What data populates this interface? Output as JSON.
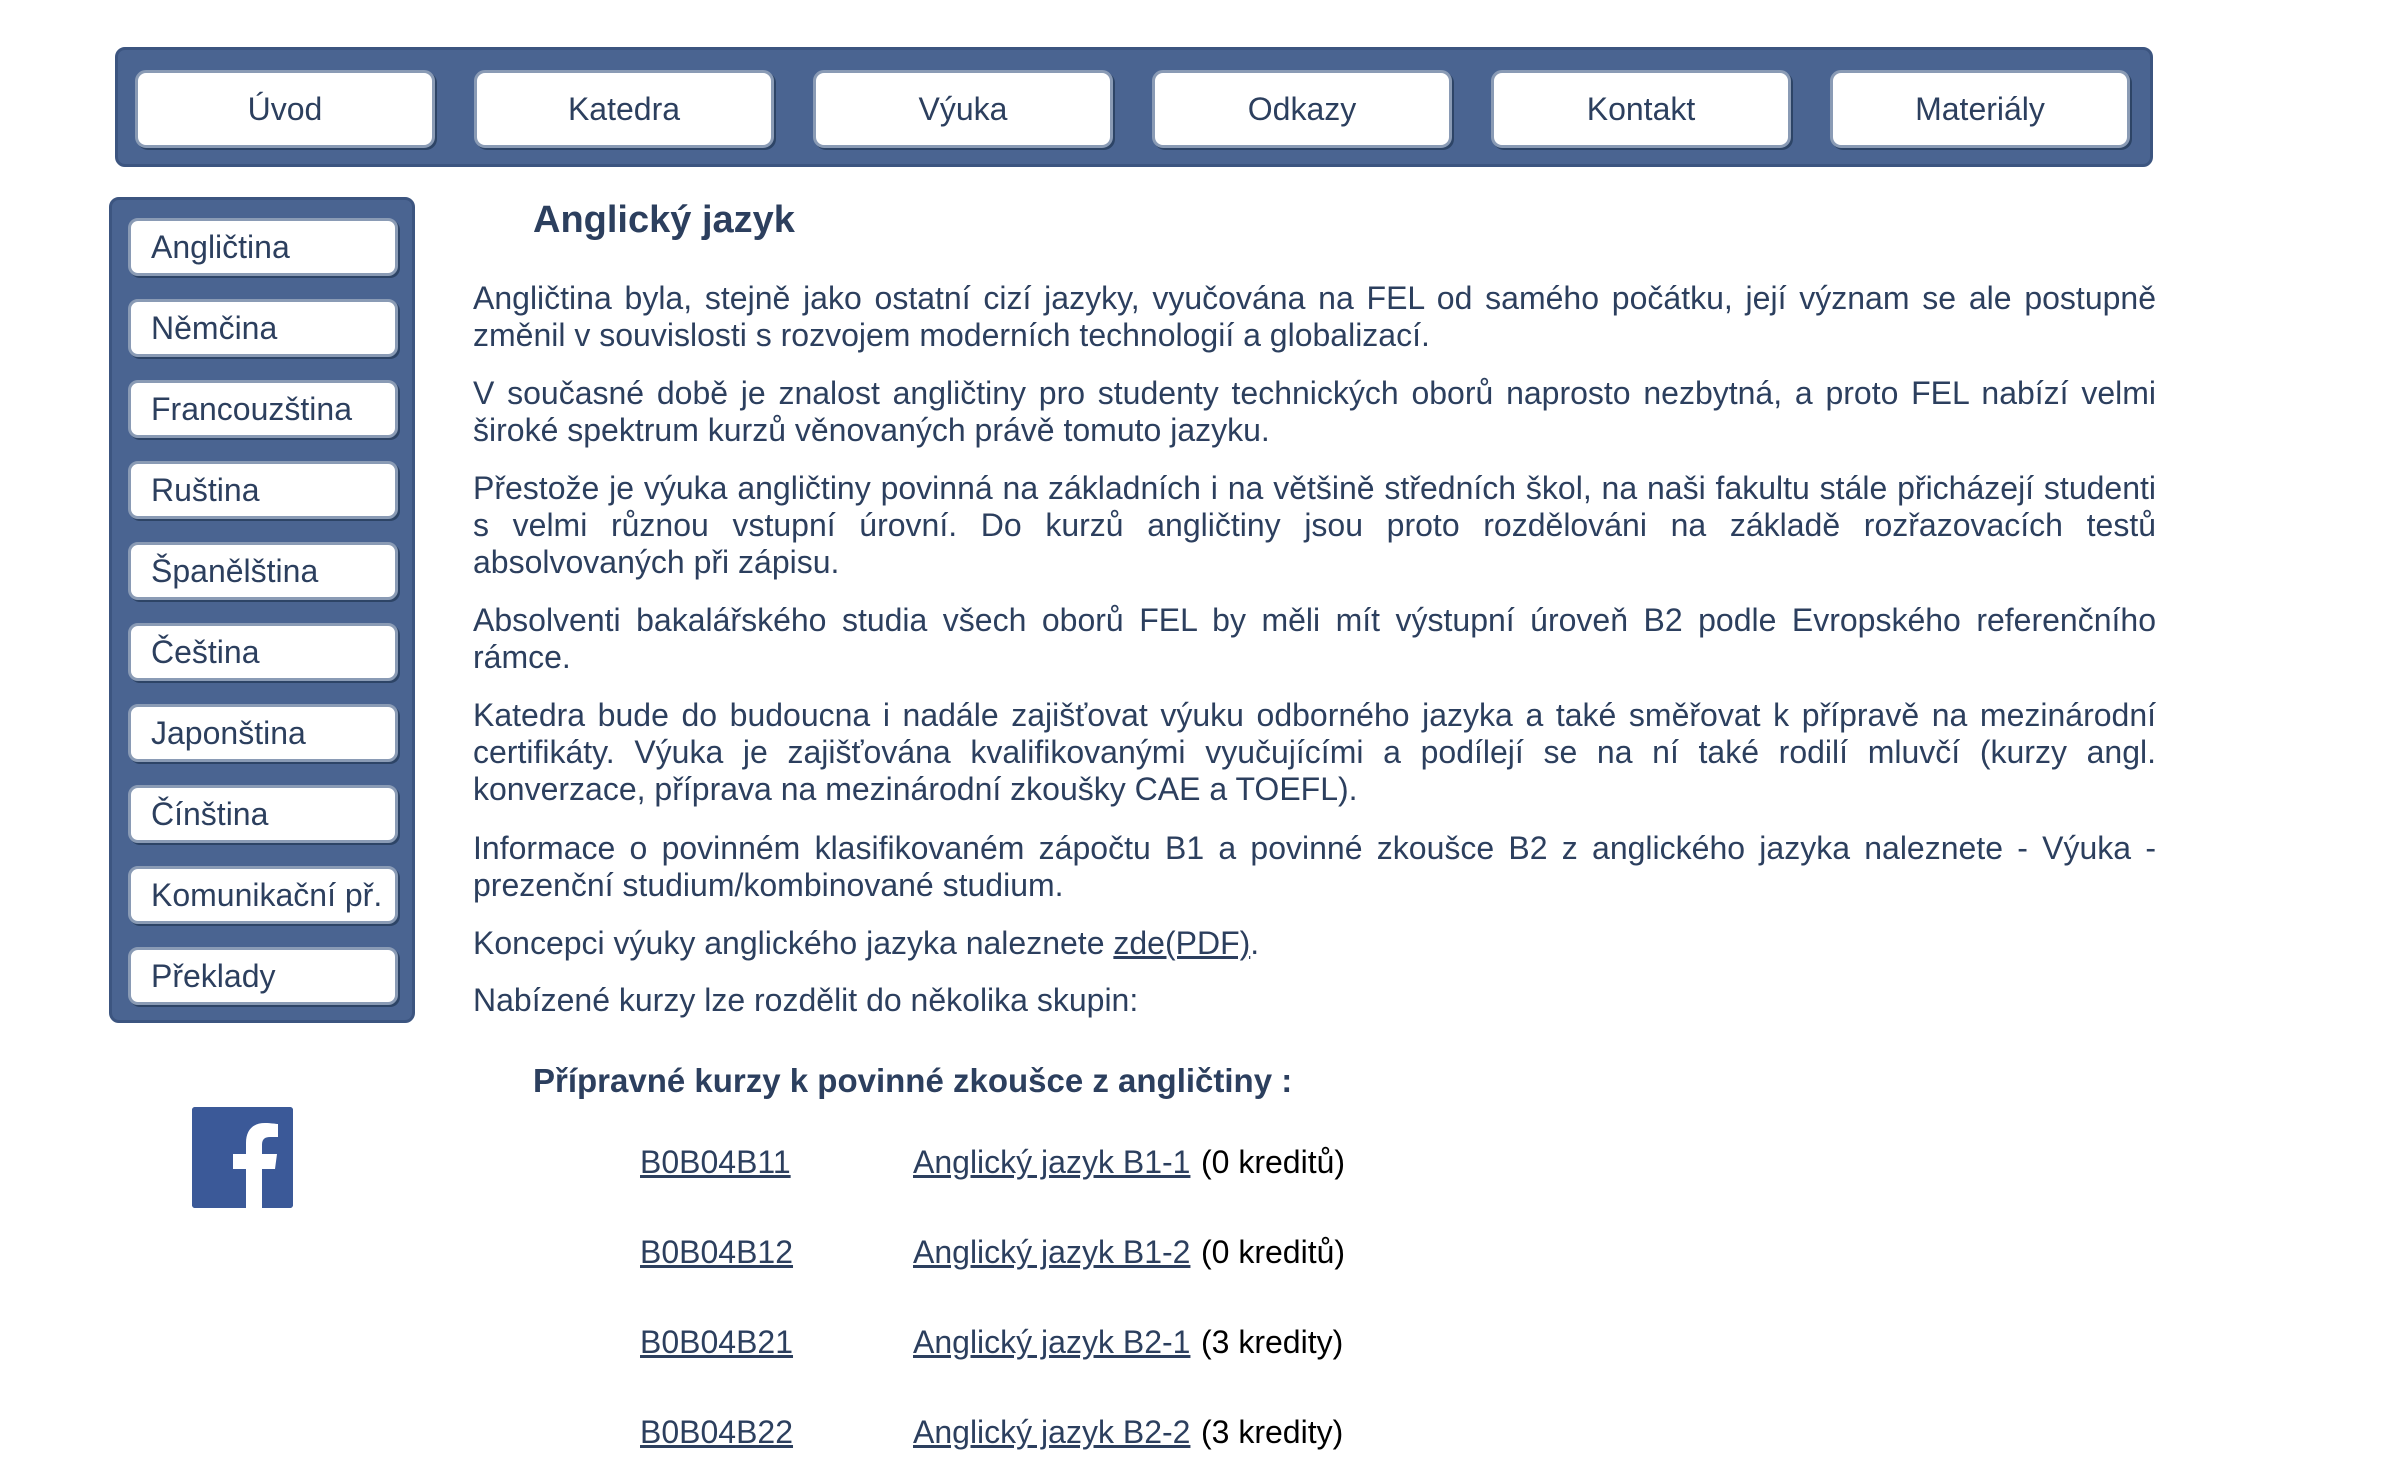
{
  "top_nav": {
    "items": [
      {
        "label": "Úvod"
      },
      {
        "label": "Katedra"
      },
      {
        "label": "Výuka"
      },
      {
        "label": "Odkazy"
      },
      {
        "label": "Kontakt"
      },
      {
        "label": "Materiály"
      }
    ]
  },
  "side_nav": {
    "items": [
      {
        "label": "Angličtina"
      },
      {
        "label": "Němčina"
      },
      {
        "label": "Francouzština"
      },
      {
        "label": "Ruština"
      },
      {
        "label": "Španělština"
      },
      {
        "label": "Čeština"
      },
      {
        "label": "Japonština"
      },
      {
        "label": "Čínština"
      },
      {
        "label": "Komunikační př."
      },
      {
        "label": "Překlady"
      }
    ]
  },
  "social": {
    "icon": "facebook-icon",
    "color": "#3b5998"
  },
  "main": {
    "title": "Anglický jazyk",
    "paragraphs": [
      "Angličtina byla, stejně jako ostatní cizí jazyky, vyučována na FEL od samého počátku, její význam se ale postupně změnil v souvislosti s rozvojem moderních technologií a globalizací.",
      "V současné době je znalost angličtiny pro studenty technických oborů naprosto nezbytná, a proto FEL nabízí velmi široké spektrum kurzů věnovaných právě tomuto jazyku.",
      "Přestože je výuka angličtiny povinná na základních i na většině středních škol, na naši fakultu stále přicházejí studenti s velmi různou vstupní úrovní. Do kurzů angličtiny jsou proto rozdělováni na základě rozřazovacích testů absolvovaných při zápisu.",
      "Absolventi bakalářského studia všech oborů FEL by měli mít výstupní úroveň B2 podle Evropského referenčního rámce.",
      "Katedra bude do budoucna i nadále zajišťovat výuku odborného jazyka a také směřovat k přípravě na mezinárodní certifikáty. Výuka je zajišťována kvalifikovanými vyučujícími a podílejí se na ní také rodilí mluvčí (kurzy angl. konverzace, příprava na mezinárodní zkoušky CAE a TOEFL).",
      "Informace o povinném klasifikovaném zápočtu B1 a povinné zkoušce B2 z anglického jazyka naleznete  - Výuka - prezenční studium/kombinované studium."
    ],
    "concept": {
      "before": "Koncepci výuky anglického jazyka naleznete ",
      "link": "zde(PDF)",
      "after": "."
    },
    "groups_intro": "Nabízené kurzy lze rozdělit do několika skupin:",
    "section_title": "Přípravné kurzy k povinné zkoušce z angličtiny :",
    "courses": [
      {
        "code": "B0B04B11",
        "name": "Anglický jazyk B1-1 ",
        "credits": "(0 kreditů)"
      },
      {
        "code": "B0B04B12",
        "name": "Anglický jazyk B1-2 ",
        "credits": "(0 kreditů)"
      },
      {
        "code": "B0B04B21",
        "name": "Anglický jazyk B2-1 ",
        "credits": "(3 kredity)"
      },
      {
        "code": "B0B04B22",
        "name": "Anglický jazyk B2-2 ",
        "credits": "(3 kredity)"
      }
    ]
  }
}
